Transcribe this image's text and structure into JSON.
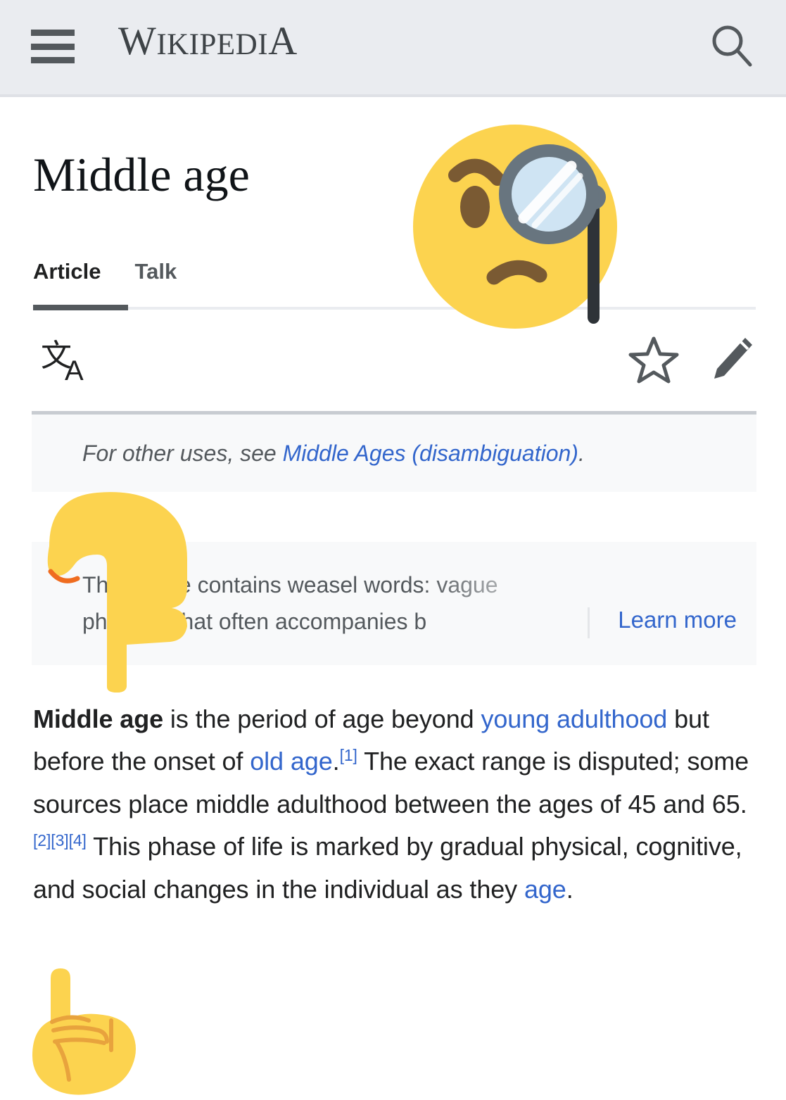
{
  "header": {
    "menu_icon": "hamburger-menu-icon",
    "wordmark_first_letter": "W",
    "wordmark_rest": "IKIPEDI",
    "wordmark_last_letter": "A",
    "search_icon": "search-icon"
  },
  "article": {
    "title": "Middle age",
    "tabs": [
      {
        "label": "Article",
        "active": true
      },
      {
        "label": "Talk",
        "active": false
      }
    ],
    "actions": [
      {
        "name": "language-icon",
        "label": "文A"
      },
      {
        "name": "watch-star-icon",
        "label": "star"
      },
      {
        "name": "edit-pencil-icon",
        "label": "pencil"
      }
    ]
  },
  "hatnote": {
    "prefix": "For other uses, see ",
    "link": "Middle Ages (disambiguation)",
    "suffix": "."
  },
  "weasel_notice": {
    "text": "This article contains weasel words: vague phrasing that often accompanies b",
    "learn_more": "Learn more"
  },
  "lead": {
    "bold_term": "Middle age",
    "s1": " is the period of age beyond ",
    "link1": "young adulthood",
    "s2": " but before the onset of ",
    "link2": "old age",
    "s3": ".",
    "ref1": "[1]",
    "s4": " The exact range is disputed; some sources place middle adulthood between the ages of 45 and 65.",
    "ref2": "[2]",
    "ref3": "[3]",
    "ref4": "[4]",
    "s5": " This phase of life is marked by gradual physical, cognitive, and social changes in the individual as they ",
    "link3": "age",
    "s6": "."
  },
  "overlays": [
    {
      "name": "face-with-monocle-emoji",
      "glyph": "🧐"
    },
    {
      "name": "backhand-index-pointing-down-emoji",
      "glyph": "👇"
    },
    {
      "name": "index-pointing-up-emoji",
      "glyph": "☝"
    }
  ],
  "colors": {
    "link_blue": "#3366cc",
    "header_bg": "#eaecf0",
    "notice_bg": "#f8f9fa",
    "text": "#202122",
    "muted_text": "#54595d",
    "emoji_yellow": "#fcd34f"
  }
}
